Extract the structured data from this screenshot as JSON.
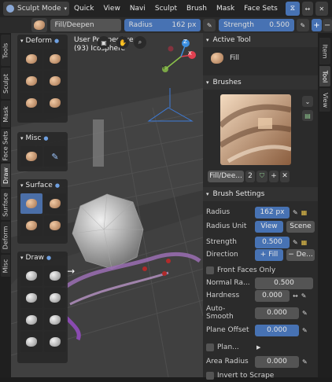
{
  "header": {
    "mode": "Sculpt Mode",
    "menus": [
      "Quick",
      "View",
      "Navi",
      "Sculpt",
      "Brush",
      "Mask",
      "Face Sets"
    ]
  },
  "toolbar": {
    "brush_name": "Fill/Deepen",
    "radius_label": "Radius",
    "radius_value": "162 px",
    "strength_label": "Strength",
    "strength_value": "0.500"
  },
  "viewport": {
    "perspective_line1": "User Perspective",
    "perspective_line2": "(93) Icosphere",
    "gizmo": {
      "x": "X",
      "y": "Y",
      "z": "Z"
    }
  },
  "left_tabs": [
    "Tools",
    "Sculpt",
    "Mask",
    "Face Sets",
    "Draw",
    "Surface",
    "Deform",
    "Misc"
  ],
  "tool_panels": {
    "deform": {
      "title": "Deform"
    },
    "misc": {
      "title": "Misc"
    },
    "surface": {
      "title": "Surface"
    },
    "draw": {
      "title": "Draw"
    }
  },
  "right_tabs": [
    "Item",
    "Tool",
    "View"
  ],
  "active_tool": {
    "title": "Active Tool",
    "name": "Fill"
  },
  "brushes": {
    "title": "Brushes",
    "name": "Fill/Dee...",
    "users": "2"
  },
  "brush_settings": {
    "title": "Brush Settings",
    "radius_label": "Radius",
    "radius_value": "162 px",
    "radius_unit_label": "Radius Unit",
    "radius_unit_options": [
      "View",
      "Scene"
    ],
    "strength_label": "Strength",
    "strength_value": "0.500",
    "direction_label": "Direction",
    "direction_options": [
      "+ Fill",
      "− De..."
    ],
    "front_faces_label": "Front Faces Only",
    "normal_radius_label": "Normal Ra...",
    "normal_radius_value": "0.500",
    "hardness_label": "Hardness",
    "hardness_value": "0.000",
    "auto_smooth_label": "Auto-Smooth",
    "auto_smooth_value": "0.000",
    "plane_offset_label": "Plane Offset",
    "plane_offset_value": "0.000",
    "plane_trim_label": "Plan...",
    "area_radius_label": "Area Radius",
    "area_radius_value": "0.000",
    "invert_label": "Invert to Scrape"
  },
  "colors": {
    "accent": "#4772b3",
    "panel": "#2b2b2b",
    "background": "#1d1d1d"
  }
}
